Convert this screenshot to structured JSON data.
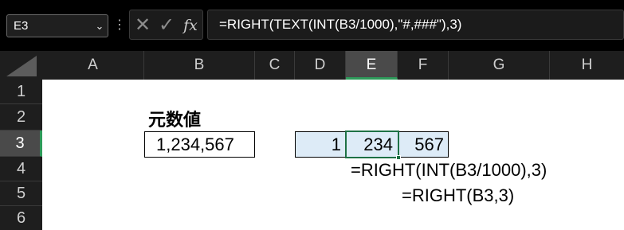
{
  "formula_bar": {
    "name_box": "E3",
    "name_box_arrow": "⌄",
    "more_dots": "⋮",
    "cancel_symbol": "✕",
    "enter_symbol": "✓",
    "fx_label": "fx",
    "formula": "=RIGHT(TEXT(INT(B3/1000),\"#,###\"),3)"
  },
  "columns": [
    "A",
    "B",
    "C",
    "D",
    "E",
    "F",
    "G",
    "H"
  ],
  "rows": [
    "1",
    "2",
    "3",
    "4",
    "5",
    "6"
  ],
  "selected_cell": "E3",
  "cells": {
    "B2": "元数値",
    "B3": "1,234,567",
    "D3": "1",
    "E3": "234",
    "F3": "567"
  },
  "annotations": {
    "formula_e": "=RIGHT(INT(B3/1000),3)",
    "formula_f": "=RIGHT(B3,3)"
  },
  "colors": {
    "selection_green": "#1e7145",
    "highlight_blue": "#ddebf7",
    "header_dark": "#1e1e1e"
  }
}
